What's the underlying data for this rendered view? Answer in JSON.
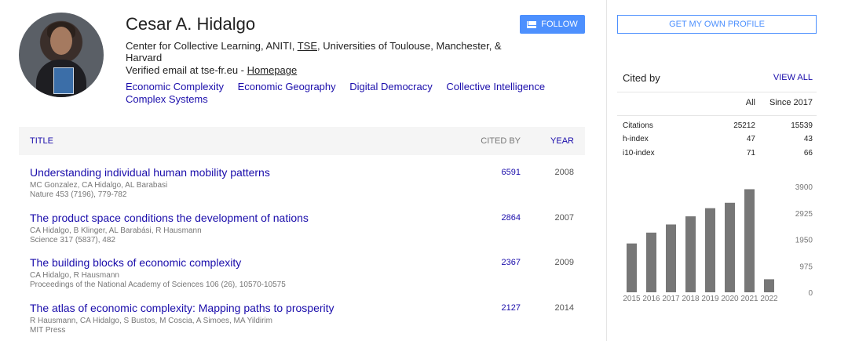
{
  "profile": {
    "name": "Cesar A. Hidalgo",
    "affiliation_pre": "Center for Collective Learning, ANITI, ",
    "affiliation_link": "TSE",
    "affiliation_post": ", Universities of Toulouse, Manchester, & Harvard",
    "email_text": "Verified email at tse-fr.eu - ",
    "homepage_label": "Homepage",
    "interests": [
      "Economic Complexity",
      "Economic Geography",
      "Digital Democracy",
      "Collective Intelligence",
      "Complex Systems"
    ],
    "follow_label": "FOLLOW"
  },
  "table": {
    "col_title": "TITLE",
    "col_cited": "CITED BY",
    "col_year": "YEAR",
    "rows": [
      {
        "title": "Understanding individual human mobility patterns",
        "authors": "MC Gonzalez, CA Hidalgo, AL Barabasi",
        "venue": "Nature 453 (7196), 779-782",
        "cited": "6591",
        "year": "2008"
      },
      {
        "title": "The product space conditions the development of nations",
        "authors": "CA Hidalgo, B Klinger, AL Barabási, R Hausmann",
        "venue": "Science 317 (5837), 482",
        "cited": "2864",
        "year": "2007"
      },
      {
        "title": "The building blocks of economic complexity",
        "authors": "CA Hidalgo, R Hausmann",
        "venue": "Proceedings of the National Academy of Sciences 106 (26), 10570-10575",
        "cited": "2367",
        "year": "2009"
      },
      {
        "title": "The atlas of economic complexity: Mapping paths to prosperity",
        "authors": "R Hausmann, CA Hidalgo, S Bustos, M Coscia, A Simoes, MA Yildirim",
        "venue": "MIT Press",
        "cited": "2127",
        "year": "2014"
      }
    ]
  },
  "sidebar": {
    "get_profile": "GET MY OWN PROFILE",
    "cited_by": "Cited by",
    "view_all": "VIEW ALL",
    "col_all": "All",
    "col_since": "Since 2017",
    "stats": [
      {
        "label": "Citations",
        "all": "25212",
        "since": "15539"
      },
      {
        "label": "h-index",
        "all": "47",
        "since": "43"
      },
      {
        "label": "i10-index",
        "all": "71",
        "since": "66"
      }
    ]
  },
  "chart_data": {
    "type": "bar",
    "categories": [
      "2015",
      "2016",
      "2017",
      "2018",
      "2019",
      "2020",
      "2021",
      "2022"
    ],
    "values": [
      1800,
      2200,
      2500,
      2800,
      3100,
      3300,
      3800,
      480
    ],
    "yticks": [
      "3900",
      "2925",
      "1950",
      "975",
      "0"
    ],
    "ylim": [
      0,
      3900
    ],
    "bar_color": "#777777"
  }
}
